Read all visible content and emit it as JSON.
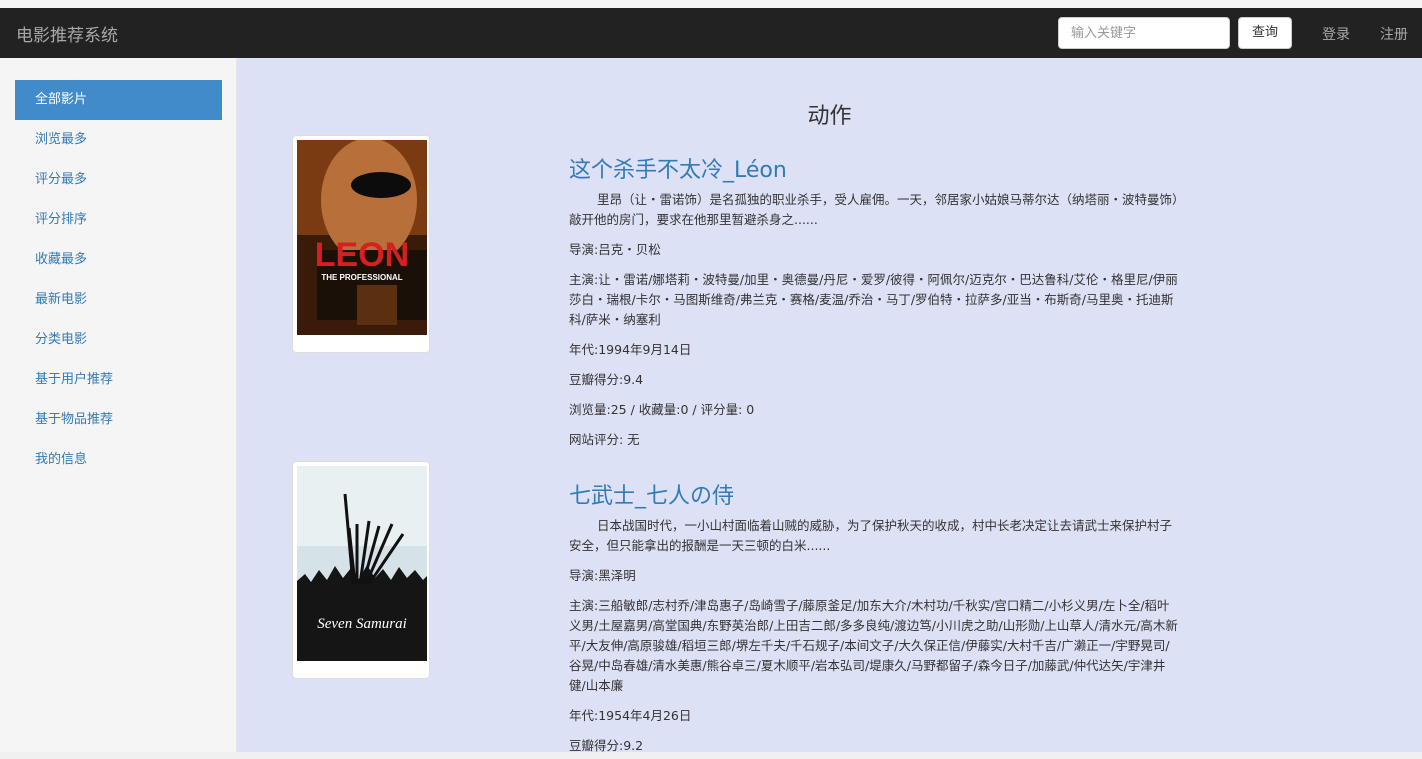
{
  "app": {
    "brand": "电影推荐系统"
  },
  "navbar": {
    "search_placeholder": "输入关键字",
    "search_button": "查询",
    "login": "登录",
    "register": "注册"
  },
  "sidebar": {
    "items": [
      {
        "label": "全部影片",
        "active": true
      },
      {
        "label": "浏览最多"
      },
      {
        "label": "评分最多"
      },
      {
        "label": "评分排序"
      },
      {
        "label": "收藏最多"
      },
      {
        "label": "最新电影"
      },
      {
        "label": "分类电影"
      },
      {
        "label": "基于用户推荐"
      },
      {
        "label": "基于物品推荐"
      },
      {
        "label": "我的信息"
      }
    ]
  },
  "main": {
    "category": "动作",
    "movies": [
      {
        "title": "这个杀手不太冷_Léon",
        "summary": "里昂（让・雷诺饰）是名孤独的职业杀手，受人雇佣。一天，邻居家小姑娘马蒂尔达（纳塔丽・波特曼饰）敲开他的房门，要求在他那里暂避杀身之......",
        "director": "导演:吕克・贝松",
        "cast": "主演:让・雷诺/娜塔莉・波特曼/加里・奥德曼/丹尼・爱罗/彼得・阿佩尔/迈克尔・巴达鲁科/艾伦・格里尼/伊丽莎白・瑞根/卡尔・马图斯维奇/弗兰克・赛格/麦温/乔治・马丁/罗伯特・拉萨多/亚当・布斯奇/马里奥・托迪斯科/萨米・纳塞利",
        "year": "年代:1994年9月14日",
        "douban": "豆瓣得分:9.4",
        "stats": "浏览量:25 / 收藏量:0 / 评分量: 0",
        "site_rating": "网站评分: 无",
        "poster_text": "LEON",
        "poster_subtitle": "THE PROFESSIONAL"
      },
      {
        "title": "七武士_七人の侍",
        "summary": "日本战国时代，一小山村面临着山贼的威胁，为了保护秋天的收成，村中长老决定让去请武士来保护村子安全，但只能拿出的报酬是一天三顿的白米......",
        "director": "导演:黑泽明",
        "cast": "主演:三船敏郎/志村乔/津岛惠子/岛崎雪子/藤原釜足/加东大介/木村功/千秋实/宫口精二/小杉义男/左卜全/稻叶义男/土屋嘉男/高堂国典/东野英治郎/上田吉二郎/多多良纯/渡边笃/小川虎之助/山形勋/上山草人/清水元/高木新平/大友伸/高原骏雄/稻垣三郎/堺左千夫/千石规子/本间文子/大久保正信/伊藤实/大村千吉/广濑正一/宇野晃司/谷晃/中岛春雄/清水美惠/熊谷卓三/夏木顺平/岩本弘司/堤康久/马野都留子/森今日子/加藤武/仲代达矢/宇津井健/山本廉",
        "year": "年代:1954年4月26日",
        "douban": "豆瓣得分:9.2",
        "poster_text": "Seven Samurai"
      }
    ]
  },
  "colors": {
    "navbar": "#222222",
    "sidebar_active": "#428bca",
    "link": "#337ab7",
    "main_bg": "#dce1f5"
  }
}
